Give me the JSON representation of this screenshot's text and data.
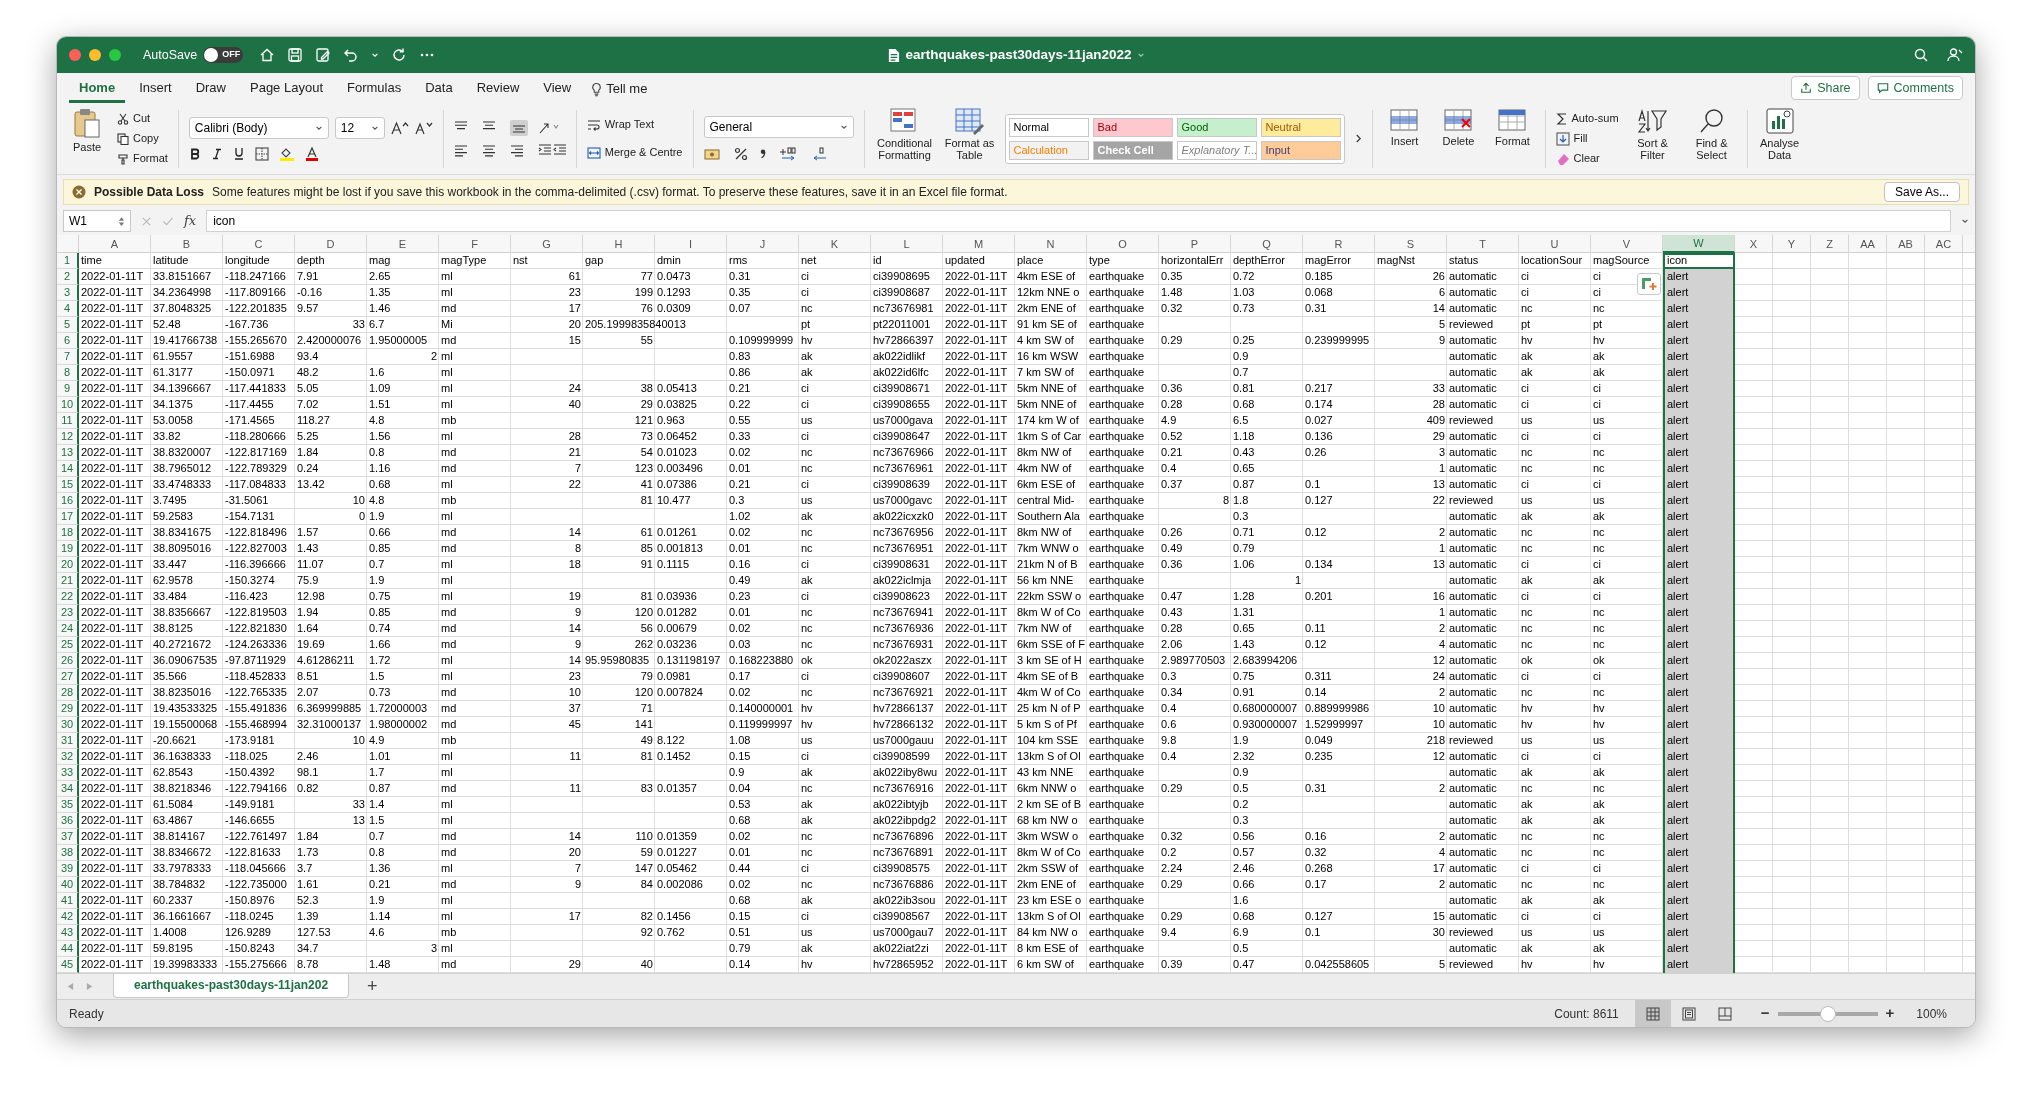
{
  "window": {
    "title": "earthquakes-past30days-11jan2022",
    "autosave_label": "AutoSave",
    "autosave_on": false,
    "autosave_state": "OFF"
  },
  "ribbon_tabs": [
    {
      "label": "Home",
      "selected": true
    },
    {
      "label": "Insert",
      "selected": false
    },
    {
      "label": "Draw",
      "selected": false
    },
    {
      "label": "Page Layout",
      "selected": false
    },
    {
      "label": "Formulas",
      "selected": false
    },
    {
      "label": "Data",
      "selected": false
    },
    {
      "label": "Review",
      "selected": false
    },
    {
      "label": "View",
      "selected": false
    }
  ],
  "tell_me": "Tell me",
  "share": "Share",
  "comments": "Comments",
  "clipboard": {
    "paste": "Paste",
    "cut": "Cut",
    "copy": "Copy",
    "format": "Format"
  },
  "font": {
    "name": "Calibri (Body)",
    "size": "12"
  },
  "alignment": {
    "wrap": "Wrap Text",
    "merge": "Merge & Centre"
  },
  "number_format": "General",
  "style_buttons": [
    "Conditional Formatting",
    "Format as Table"
  ],
  "cell_styles": [
    {
      "label": "Normal",
      "color": "#ffffff"
    },
    {
      "label": "Bad",
      "color": "#ffc7ce"
    },
    {
      "label": "Good",
      "color": "#c6efce"
    },
    {
      "label": "Neutral",
      "color": "#ffeb9c"
    },
    {
      "label": "Calculation",
      "color": "#f2f2f2"
    },
    {
      "label": "Check Cell",
      "color": "#a5a5a5"
    },
    {
      "label": "Explanatory T...",
      "color": "#ffffff"
    },
    {
      "label": "Input",
      "color": "#ffcc99"
    }
  ],
  "cells_group": [
    "Insert",
    "Delete",
    "Format"
  ],
  "editing": {
    "autosum": "Auto-sum",
    "fill": "Fill",
    "clear": "Clear",
    "sort": "Sort & Filter",
    "find": "Find & Select"
  },
  "analyse": "Analyse Data",
  "message_bar": {
    "title": "Possible Data Loss",
    "text": "Some features might be lost if you save this workbook in the comma-delimited (.csv) format. To preserve these features, save it in an Excel file format.",
    "button": "Save As..."
  },
  "formula_bar": {
    "name_box": "W1",
    "fx": "fx",
    "formula": "icon"
  },
  "columns": [
    {
      "label": "A",
      "selected": false
    },
    {
      "label": "B",
      "selected": false
    },
    {
      "label": "C",
      "selected": false
    },
    {
      "label": "D",
      "selected": false
    },
    {
      "label": "E",
      "selected": false
    },
    {
      "label": "F",
      "selected": false
    },
    {
      "label": "G",
      "selected": false
    },
    {
      "label": "H",
      "selected": false
    },
    {
      "label": "I",
      "selected": false
    },
    {
      "label": "J",
      "selected": false
    },
    {
      "label": "K",
      "selected": false
    },
    {
      "label": "L",
      "selected": false
    },
    {
      "label": "M",
      "selected": false
    },
    {
      "label": "N",
      "selected": false
    },
    {
      "label": "O",
      "selected": false
    },
    {
      "label": "P",
      "selected": false
    },
    {
      "label": "Q",
      "selected": false
    },
    {
      "label": "R",
      "selected": false
    },
    {
      "label": "S",
      "selected": false
    },
    {
      "label": "T",
      "selected": false
    },
    {
      "label": "U",
      "selected": false
    },
    {
      "label": "V",
      "selected": false
    },
    {
      "label": "W",
      "selected": true
    },
    {
      "label": "X",
      "selected": false
    },
    {
      "label": "Y",
      "selected": false
    },
    {
      "label": "Z",
      "selected": false
    },
    {
      "label": "AA",
      "selected": false
    },
    {
      "label": "AB",
      "selected": false
    },
    {
      "label": "AC",
      "selected": false
    }
  ],
  "rows": [
    {
      "row": "1",
      "cells": [
        "time",
        "latitude",
        "longitude",
        "depth",
        "mag",
        "magType",
        "nst",
        "gap",
        "dmin",
        "rms",
        "net",
        "id",
        "updated",
        "place",
        "type",
        "horizontalErr",
        "depthError",
        "magError",
        "magNst",
        "status",
        "locationSour",
        "magSource",
        "icon"
      ]
    },
    {
      "row": "2",
      "cells": [
        "2022-01-11T",
        "33.8151667",
        "-118.247166",
        "7.91",
        "2.65",
        "ml",
        {
          "number": "61"
        },
        {
          "number": "77"
        },
        "0.0473",
        "0.31",
        "ci",
        "ci39908695",
        "2022-01-11T",
        "4km ESE of",
        "earthquake",
        "0.35",
        "0.72",
        "0.185",
        {
          "number": "26"
        },
        "automatic",
        "ci",
        "ci",
        "alert"
      ]
    },
    {
      "row": "3",
      "cells": [
        "2022-01-11T",
        "34.2364998",
        "-117.809166",
        "-0.16",
        "1.35",
        "ml",
        {
          "number": "23"
        },
        {
          "number": "199"
        },
        "0.1293",
        "0.35",
        "ci",
        "ci39908687",
        "2022-01-11T",
        "12km NNE o",
        "earthquake",
        "1.48",
        "1.03",
        "0.068",
        {
          "number": "6"
        },
        "automatic",
        "ci",
        "ci",
        "alert"
      ]
    },
    {
      "row": "4",
      "cells": [
        "2022-01-11T",
        "37.8048325",
        "-122.201835",
        "9.57",
        "1.46",
        "md",
        {
          "number": "17"
        },
        {
          "number": "76"
        },
        "0.0309",
        "0.07",
        "nc",
        "nc73676981",
        "2022-01-11T",
        "2km ENE of",
        "earthquake",
        "0.32",
        "0.73",
        "0.31",
        {
          "number": "14"
        },
        "automatic",
        "nc",
        "nc",
        "alert"
      ]
    },
    {
      "row": "5",
      "cells": [
        "2022-01-11T",
        "52.48",
        "-167.736",
        {
          "number": "33"
        },
        "6.7",
        "Mi",
        {
          "number": "20"
        },
        "205.1999835840013",
        null,
        null,
        "pt",
        "pt22011001",
        "2022-01-11T",
        "91 km SE of",
        "earthquake",
        null,
        null,
        null,
        {
          "number": "5"
        },
        "reviewed",
        "pt",
        "pt",
        "alert"
      ]
    },
    {
      "row": "6",
      "cells": [
        "2022-01-11T",
        "19.41766738",
        "-155.265670",
        "2.420000076",
        "1.95000005",
        "md",
        {
          "number": "15"
        },
        {
          "number": "55"
        },
        null,
        "0.109999999",
        "hv",
        "hv72866397",
        "2022-01-11T",
        "4 km SW of",
        "earthquake",
        "0.29",
        "0.25",
        "0.239999995",
        {
          "number": "9"
        },
        "automatic",
        "hv",
        "hv",
        "alert"
      ]
    },
    {
      "row": "7",
      "cells": [
        "2022-01-11T",
        "61.9557",
        "-151.6988",
        "93.4",
        {
          "number": "2"
        },
        "ml",
        null,
        null,
        null,
        "0.83",
        "ak",
        "ak022idlikf",
        "2022-01-11T",
        "16 km WSW",
        "earthquake",
        null,
        "0.9",
        null,
        null,
        "automatic",
        "ak",
        "ak",
        "alert"
      ]
    },
    {
      "row": "8",
      "cells": [
        "2022-01-11T",
        "61.3177",
        "-150.0971",
        "48.2",
        "1.6",
        "ml",
        null,
        null,
        null,
        "0.86",
        "ak",
        "ak022id6lfc",
        "2022-01-11T",
        "7 km SW of",
        "earthquake",
        null,
        "0.7",
        null,
        null,
        "automatic",
        "ak",
        "ak",
        "alert"
      ]
    },
    {
      "row": "9",
      "cells": [
        "2022-01-11T",
        "34.1396667",
        "-117.441833",
        "5.05",
        "1.09",
        "ml",
        {
          "number": "24"
        },
        {
          "number": "38"
        },
        "0.05413",
        "0.21",
        "ci",
        "ci39908671",
        "2022-01-11T",
        "5km NNE of",
        "earthquake",
        "0.36",
        "0.81",
        "0.217",
        {
          "number": "33"
        },
        "automatic",
        "ci",
        "ci",
        "alert"
      ]
    },
    {
      "row": "10",
      "cells": [
        "2022-01-11T",
        "34.1375",
        "-117.4455",
        "7.02",
        "1.51",
        "ml",
        {
          "number": "40"
        },
        {
          "number": "29"
        },
        "0.03825",
        "0.22",
        "ci",
        "ci39908655",
        "2022-01-11T",
        "5km NNE of",
        "earthquake",
        "0.28",
        "0.68",
        "0.174",
        {
          "number": "28"
        },
        "automatic",
        "ci",
        "ci",
        "alert"
      ]
    },
    {
      "row": "11",
      "cells": [
        "2022-01-11T",
        "53.0058",
        "-171.4565",
        "118.27",
        "4.8",
        "mb",
        null,
        {
          "number": "121"
        },
        "0.963",
        "0.55",
        "us",
        "us7000gava",
        "2022-01-11T",
        "174 km W of",
        "earthquake",
        "4.9",
        "6.5",
        "0.027",
        {
          "number": "409"
        },
        "reviewed",
        "us",
        "us",
        "alert"
      ]
    },
    {
      "row": "12",
      "cells": [
        "2022-01-11T",
        "33.82",
        "-118.280666",
        "5.25",
        "1.56",
        "ml",
        {
          "number": "28"
        },
        {
          "number": "73"
        },
        "0.06452",
        "0.33",
        "ci",
        "ci39908647",
        "2022-01-11T",
        "1km S of Car",
        "earthquake",
        "0.52",
        "1.18",
        "0.136",
        {
          "number": "29"
        },
        "automatic",
        "ci",
        "ci",
        "alert"
      ]
    },
    {
      "row": "13",
      "cells": [
        "2022-01-11T",
        "38.8320007",
        "-122.817169",
        "1.84",
        "0.8",
        "md",
        {
          "number": "21"
        },
        {
          "number": "54"
        },
        "0.01023",
        "0.02",
        "nc",
        "nc73676966",
        "2022-01-11T",
        "8km NW of",
        "earthquake",
        "0.21",
        "0.43",
        "0.26",
        {
          "number": "3"
        },
        "automatic",
        "nc",
        "nc",
        "alert"
      ]
    },
    {
      "row": "14",
      "cells": [
        "2022-01-11T",
        "38.7965012",
        "-122.789329",
        "0.24",
        "1.16",
        "md",
        {
          "number": "7"
        },
        {
          "number": "123"
        },
        "0.003496",
        "0.01",
        "nc",
        "nc73676961",
        "2022-01-11T",
        "4km NW of",
        "earthquake",
        "0.4",
        "0.65",
        null,
        {
          "number": "1"
        },
        "automatic",
        "nc",
        "nc",
        "alert"
      ]
    },
    {
      "row": "15",
      "cells": [
        "2022-01-11T",
        "33.4748333",
        "-117.084833",
        "13.42",
        "0.68",
        "ml",
        {
          "number": "22"
        },
        {
          "number": "41"
        },
        "0.07386",
        "0.21",
        "ci",
        "ci39908639",
        "2022-01-11T",
        "6km ESE of",
        "earthquake",
        "0.37",
        "0.87",
        "0.1",
        {
          "number": "13"
        },
        "automatic",
        "ci",
        "ci",
        "alert"
      ]
    },
    {
      "row": "16",
      "cells": [
        "2022-01-11T",
        "3.7495",
        "-31.5061",
        {
          "number": "10"
        },
        "4.8",
        "mb",
        null,
        {
          "number": "81"
        },
        "10.477",
        "0.3",
        "us",
        "us7000gavc",
        "2022-01-11T",
        "central Mid-",
        "earthquake",
        {
          "number": "8"
        },
        "1.8",
        "0.127",
        {
          "number": "22"
        },
        "reviewed",
        "us",
        "us",
        "alert"
      ]
    },
    {
      "row": "17",
      "cells": [
        "2022-01-11T",
        "59.2583",
        "-154.7131",
        {
          "number": "0"
        },
        "1.9",
        "ml",
        null,
        null,
        null,
        "1.02",
        "ak",
        "ak022icxzk0",
        "2022-01-11T",
        "Southern Ala",
        "earthquake",
        null,
        "0.3",
        null,
        null,
        "automatic",
        "ak",
        "ak",
        "alert"
      ]
    },
    {
      "row": "18",
      "cells": [
        "2022-01-11T",
        "38.8341675",
        "-122.818496",
        "1.57",
        "0.66",
        "md",
        {
          "number": "14"
        },
        {
          "number": "61"
        },
        "0.01261",
        "0.02",
        "nc",
        "nc73676956",
        "2022-01-11T",
        "8km NW of",
        "earthquake",
        "0.26",
        "0.71",
        "0.12",
        {
          "number": "2"
        },
        "automatic",
        "nc",
        "nc",
        "alert"
      ]
    },
    {
      "row": "19",
      "cells": [
        "2022-01-11T",
        "38.8095016",
        "-122.827003",
        "1.43",
        "0.85",
        "md",
        {
          "number": "8"
        },
        {
          "number": "85"
        },
        "0.001813",
        "0.01",
        "nc",
        "nc73676951",
        "2022-01-11T",
        "7km WNW o",
        "earthquake",
        "0.49",
        "0.79",
        null,
        {
          "number": "1"
        },
        "automatic",
        "nc",
        "nc",
        "alert"
      ]
    },
    {
      "row": "20",
      "cells": [
        "2022-01-11T",
        "33.447",
        "-116.396666",
        "11.07",
        "0.7",
        "ml",
        {
          "number": "18"
        },
        {
          "number": "91"
        },
        "0.1115",
        "0.16",
        "ci",
        "ci39908631",
        "2022-01-11T",
        "21km N of B",
        "earthquake",
        "0.36",
        "1.06",
        "0.134",
        {
          "number": "13"
        },
        "automatic",
        "ci",
        "ci",
        "alert"
      ]
    },
    {
      "row": "21",
      "cells": [
        "2022-01-11T",
        "62.9578",
        "-150.3274",
        "75.9",
        "1.9",
        "ml",
        null,
        null,
        null,
        "0.49",
        "ak",
        "ak022iclmja",
        "2022-01-11T",
        "56 km NNE",
        "earthquake",
        null,
        {
          "number": "1"
        },
        null,
        null,
        "automatic",
        "ak",
        "ak",
        "alert"
      ]
    },
    {
      "row": "22",
      "cells": [
        "2022-01-11T",
        "33.484",
        "-116.423",
        "12.98",
        "0.75",
        "ml",
        {
          "number": "19"
        },
        {
          "number": "81"
        },
        "0.03936",
        "0.23",
        "ci",
        "ci39908623",
        "2022-01-11T",
        "22km SSW o",
        "earthquake",
        "0.47",
        "1.28",
        "0.201",
        {
          "number": "16"
        },
        "automatic",
        "ci",
        "ci",
        "alert"
      ]
    },
    {
      "row": "23",
      "cells": [
        "2022-01-11T",
        "38.8356667",
        "-122.819503",
        "1.94",
        "0.85",
        "md",
        {
          "number": "9"
        },
        {
          "number": "120"
        },
        "0.01282",
        "0.01",
        "nc",
        "nc73676941",
        "2022-01-11T",
        "8km W of Co",
        "earthquake",
        "0.43",
        "1.31",
        null,
        {
          "number": "1"
        },
        "automatic",
        "nc",
        "nc",
        "alert"
      ]
    },
    {
      "row": "24",
      "cells": [
        "2022-01-11T",
        "38.8125",
        "-122.821830",
        "1.64",
        "0.74",
        "md",
        {
          "number": "14"
        },
        {
          "number": "56"
        },
        "0.00679",
        "0.02",
        "nc",
        "nc73676936",
        "2022-01-11T",
        "7km NW of",
        "earthquake",
        "0.28",
        "0.65",
        "0.11",
        {
          "number": "2"
        },
        "automatic",
        "nc",
        "nc",
        "alert"
      ]
    },
    {
      "row": "25",
      "cells": [
        "2022-01-11T",
        "40.2721672",
        "-124.263336",
        "19.69",
        "1.66",
        "md",
        {
          "number": "9"
        },
        {
          "number": "262"
        },
        "0.03236",
        "0.03",
        "nc",
        "nc73676931",
        "2022-01-11T",
        "6km SSE of F",
        "earthquake",
        "2.06",
        "1.43",
        "0.12",
        {
          "number": "4"
        },
        "automatic",
        "nc",
        "nc",
        "alert"
      ]
    },
    {
      "row": "26",
      "cells": [
        "2022-01-11T",
        "36.09067535",
        "-97.8711929",
        "4.61286211",
        "1.72",
        "ml",
        {
          "number": "14"
        },
        "95.95980835",
        "0.131198197",
        "0.168223880",
        "ok",
        "ok2022aszx",
        "2022-01-11T",
        "3 km SE of H",
        "earthquake",
        "2.989770503",
        "2.683994206",
        null,
        {
          "number": "12"
        },
        "automatic",
        "ok",
        "ok",
        "alert"
      ]
    },
    {
      "row": "27",
      "cells": [
        "2022-01-11T",
        "35.566",
        "-118.452833",
        "8.51",
        "1.5",
        "ml",
        {
          "number": "23"
        },
        {
          "number": "79"
        },
        "0.0981",
        "0.17",
        "ci",
        "ci39908607",
        "2022-01-11T",
        "4km SE of B",
        "earthquake",
        "0.3",
        "0.75",
        "0.311",
        {
          "number": "24"
        },
        "automatic",
        "ci",
        "ci",
        "alert"
      ]
    },
    {
      "row": "28",
      "cells": [
        "2022-01-11T",
        "38.8235016",
        "-122.765335",
        "2.07",
        "0.73",
        "md",
        {
          "number": "10"
        },
        {
          "number": "120"
        },
        "0.007824",
        "0.02",
        "nc",
        "nc73676921",
        "2022-01-11T",
        "4km W of Co",
        "earthquake",
        "0.34",
        "0.91",
        "0.14",
        {
          "number": "2"
        },
        "automatic",
        "nc",
        "nc",
        "alert"
      ]
    },
    {
      "row": "29",
      "cells": [
        "2022-01-11T",
        "19.43533325",
        "-155.491836",
        "6.369999885",
        "1.72000003",
        "md",
        {
          "number": "37"
        },
        {
          "number": "71"
        },
        null,
        "0.140000001",
        "hv",
        "hv72866137",
        "2022-01-11T",
        "25 km N of P",
        "earthquake",
        "0.4",
        "0.680000007",
        "0.889999986",
        {
          "number": "10"
        },
        "automatic",
        "hv",
        "hv",
        "alert"
      ]
    },
    {
      "row": "30",
      "cells": [
        "2022-01-11T",
        "19.15500068",
        "-155.468994",
        "32.31000137",
        "1.98000002",
        "md",
        {
          "number": "45"
        },
        {
          "number": "141"
        },
        null,
        "0.119999997",
        "hv",
        "hv72866132",
        "2022-01-11T",
        "5 km S of Pf",
        "earthquake",
        "0.6",
        "0.930000007",
        "1.52999997",
        {
          "number": "10"
        },
        "automatic",
        "hv",
        "hv",
        "alert"
      ]
    },
    {
      "row": "31",
      "cells": [
        "2022-01-11T",
        "-20.6621",
        "-173.9181",
        {
          "number": "10"
        },
        "4.9",
        "mb",
        null,
        {
          "number": "49"
        },
        "8.122",
        "1.08",
        "us",
        "us7000gauu",
        "2022-01-11T",
        "104 km SSE",
        "earthquake",
        "9.8",
        "1.9",
        "0.049",
        {
          "number": "218"
        },
        "reviewed",
        "us",
        "us",
        "alert"
      ]
    },
    {
      "row": "32",
      "cells": [
        "2022-01-11T",
        "36.1638333",
        "-118.025",
        "2.46",
        "1.01",
        "ml",
        {
          "number": "11"
        },
        {
          "number": "81"
        },
        "0.1452",
        "0.15",
        "ci",
        "ci39908599",
        "2022-01-11T",
        "13km S of Ol",
        "earthquake",
        "0.4",
        "2.32",
        "0.235",
        {
          "number": "12"
        },
        "automatic",
        "ci",
        "ci",
        "alert"
      ]
    },
    {
      "row": "33",
      "cells": [
        "2022-01-11T",
        "62.8543",
        "-150.4392",
        "98.1",
        "1.7",
        "ml",
        null,
        null,
        null,
        "0.9",
        "ak",
        "ak022iby8wu",
        "2022-01-11T",
        "43 km NNE",
        "earthquake",
        null,
        "0.9",
        null,
        null,
        "automatic",
        "ak",
        "ak",
        "alert"
      ]
    },
    {
      "row": "34",
      "cells": [
        "2022-01-11T",
        "38.8218346",
        "-122.794166",
        "0.82",
        "0.87",
        "md",
        {
          "number": "11"
        },
        {
          "number": "83"
        },
        "0.01357",
        "0.04",
        "nc",
        "nc73676916",
        "2022-01-11T",
        "6km NNW o",
        "earthquake",
        "0.29",
        "0.5",
        "0.31",
        {
          "number": "2"
        },
        "automatic",
        "nc",
        "nc",
        "alert"
      ]
    },
    {
      "row": "35",
      "cells": [
        "2022-01-11T",
        "61.5084",
        "-149.9181",
        {
          "number": "33"
        },
        "1.4",
        "ml",
        null,
        null,
        null,
        "0.53",
        "ak",
        "ak022ibtyjb",
        "2022-01-11T",
        "2 km SE of B",
        "earthquake",
        null,
        "0.2",
        null,
        null,
        "automatic",
        "ak",
        "ak",
        "alert"
      ]
    },
    {
      "row": "36",
      "cells": [
        "2022-01-11T",
        "63.4867",
        "-146.6655",
        {
          "number": "13"
        },
        "1.5",
        "ml",
        null,
        null,
        null,
        "0.68",
        "ak",
        "ak022ibpdg2",
        "2022-01-11T",
        "68 km NW o",
        "earthquake",
        null,
        "0.3",
        null,
        null,
        "automatic",
        "ak",
        "ak",
        "alert"
      ]
    },
    {
      "row": "37",
      "cells": [
        "2022-01-11T",
        "38.814167",
        "-122.761497",
        "1.84",
        "0.7",
        "md",
        {
          "number": "14"
        },
        {
          "number": "110"
        },
        "0.01359",
        "0.02",
        "nc",
        "nc73676896",
        "2022-01-11T",
        "3km WSW o",
        "earthquake",
        "0.32",
        "0.56",
        "0.16",
        {
          "number": "2"
        },
        "automatic",
        "nc",
        "nc",
        "alert"
      ]
    },
    {
      "row": "38",
      "cells": [
        "2022-01-11T",
        "38.8346672",
        "-122.81633",
        "1.73",
        "0.8",
        "md",
        {
          "number": "20"
        },
        {
          "number": "59"
        },
        "0.01227",
        "0.01",
        "nc",
        "nc73676891",
        "2022-01-11T",
        "8km W of Co",
        "earthquake",
        "0.2",
        "0.57",
        "0.32",
        {
          "number": "4"
        },
        "automatic",
        "nc",
        "nc",
        "alert"
      ]
    },
    {
      "row": "39",
      "cells": [
        "2022-01-11T",
        "33.7978333",
        "-118.045666",
        "3.7",
        "1.36",
        "ml",
        {
          "number": "7"
        },
        {
          "number": "147"
        },
        "0.05462",
        "0.44",
        "ci",
        "ci39908575",
        "2022-01-11T",
        "2km SSW of",
        "earthquake",
        "2.24",
        "2.46",
        "0.268",
        {
          "number": "17"
        },
        "automatic",
        "ci",
        "ci",
        "alert"
      ]
    },
    {
      "row": "40",
      "cells": [
        "2022-01-11T",
        "38.784832",
        "-122.735000",
        "1.61",
        "0.21",
        "md",
        {
          "number": "9"
        },
        {
          "number": "84"
        },
        "0.002086",
        "0.02",
        "nc",
        "nc73676886",
        "2022-01-11T",
        "2km ENE of",
        "earthquake",
        "0.29",
        "0.66",
        "0.17",
        {
          "number": "2"
        },
        "automatic",
        "nc",
        "nc",
        "alert"
      ]
    },
    {
      "row": "41",
      "cells": [
        "2022-01-11T",
        "60.2337",
        "-150.8976",
        "52.3",
        "1.9",
        "ml",
        null,
        null,
        null,
        "0.68",
        "ak",
        "ak022ib3sou",
        "2022-01-11T",
        "23 km ESE o",
        "earthquake",
        null,
        "1.6",
        null,
        null,
        "automatic",
        "ak",
        "ak",
        "alert"
      ]
    },
    {
      "row": "42",
      "cells": [
        "2022-01-11T",
        "36.1661667",
        "-118.0245",
        "1.39",
        "1.14",
        "ml",
        {
          "number": "17"
        },
        {
          "number": "82"
        },
        "0.1456",
        "0.15",
        "ci",
        "ci39908567",
        "2022-01-11T",
        "13km S of Ol",
        "earthquake",
        "0.29",
        "0.68",
        "0.127",
        {
          "number": "15"
        },
        "automatic",
        "ci",
        "ci",
        "alert"
      ]
    },
    {
      "row": "43",
      "cells": [
        "2022-01-11T",
        "1.4008",
        "126.9289",
        "127.53",
        "4.6",
        "mb",
        null,
        {
          "number": "92"
        },
        "0.762",
        "0.51",
        "us",
        "us7000gau7",
        "2022-01-11T",
        "84 km NW o",
        "earthquake",
        "9.4",
        "6.9",
        "0.1",
        {
          "number": "30"
        },
        "reviewed",
        "us",
        "us",
        "alert"
      ]
    },
    {
      "row": "44",
      "cells": [
        "2022-01-11T",
        "59.8195",
        "-150.8243",
        "34.7",
        {
          "number": "3"
        },
        "ml",
        null,
        null,
        null,
        "0.79",
        "ak",
        "ak022iat2zi",
        "2022-01-11T",
        "8 km ESE of",
        "earthquake",
        null,
        "0.5",
        null,
        null,
        "automatic",
        "ak",
        "ak",
        "alert"
      ]
    },
    {
      "row": "45",
      "cells": [
        "2022-01-11T",
        "19.39983333",
        "-155.275666",
        "8.78",
        "1.48",
        "md",
        {
          "number": "29"
        },
        {
          "number": "40"
        },
        null,
        "0.14",
        "hv",
        "hv72865952",
        "2022-01-11T",
        "6 km SW of",
        "earthquake",
        "0.39",
        "0.47",
        "0.042558605",
        {
          "number": "5"
        },
        "reviewed",
        "hv",
        "hv",
        "alert"
      ]
    }
  ],
  "sheet_tabs": [
    {
      "label": "earthquakes-past30days-11jan202",
      "selected": true
    }
  ],
  "add_sheet": "+",
  "status_bar": {
    "ready": "Ready",
    "count": "Count: 8611",
    "zoom": "100%",
    "zoom_minus": "−",
    "zoom_plus": "+",
    "zoom_slider": {
      "level": 0.5
    },
    "views": [
      {
        "kind": "normal",
        "selected": true
      },
      {
        "kind": "page_layout",
        "selected": false
      },
      {
        "kind": "page_break",
        "selected": false
      }
    ]
  }
}
